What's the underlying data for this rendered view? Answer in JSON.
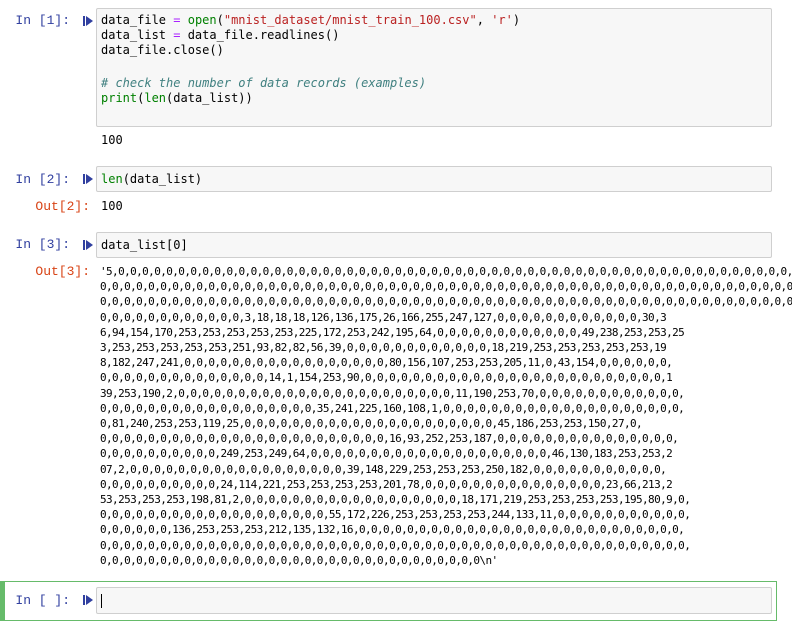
{
  "cells": [
    {
      "in_prompt": "In [1]:",
      "code": [
        "data_file = open(\"mnist_dataset/mnist_train_100.csv\", 'r')",
        "data_list = data_file.readlines()",
        "data_file.close()",
        "",
        "# check the number of data records (examples)",
        "print(len(data_list))"
      ],
      "output": "100"
    },
    {
      "in_prompt": "In [2]:",
      "code": [
        "len(data_list)"
      ],
      "out_prompt": "Out[2]:",
      "output": "100"
    },
    {
      "in_prompt": "In [3]:",
      "code": [
        "data_list[0]"
      ],
      "out_prompt": "Out[3]:",
      "output_lines": [
        "'5,0,0,0,0,0,0,0,0,0,0,0,0,0,0,0,0,0,0,0,0,0,0,0,0,0,0,0,0,0,0,0,0,0,0,0,0,0,0,0,0,0,0,0,0,0,0,0,0,0,0,0,0,0,0,0,0,",
        "0,0,0,0,0,0,0,0,0,0,0,0,0,0,0,0,0,0,0,0,0,0,0,0,0,0,0,0,0,0,0,0,0,0,0,0,0,0,0,0,0,0,0,0,0,0,0,0,0,0,0,0,0,0,0,0,0,0,",
        "0,0,0,0,0,0,0,0,0,0,0,0,0,0,0,0,0,0,0,0,0,0,0,0,0,0,0,0,0,0,0,0,0,0,0,0,0,0,0,0,0,0,0,0,0,0,0,0,0,0,0,0,0,0,0,0,0,0,",
        "0,0,0,0,0,0,0,0,0,0,0,0,3,18,18,18,126,136,175,26,166,255,247,127,0,0,0,0,0,0,0,0,0,0,0,0,30,3",
        "6,94,154,170,253,253,253,253,253,225,172,253,242,195,64,0,0,0,0,0,0,0,0,0,0,0,0,49,238,253,253,25",
        "3,253,253,253,253,253,251,93,82,82,56,39,0,0,0,0,0,0,0,0,0,0,0,0,18,219,253,253,253,253,253,19",
        "8,182,247,241,0,0,0,0,0,0,0,0,0,0,0,0,0,0,0,0,0,80,156,107,253,253,205,11,0,43,154,0,0,0,0,0,0,",
        "0,0,0,0,0,0,0,0,0,0,0,0,0,0,14,1,154,253,90,0,0,0,0,0,0,0,0,0,0,0,0,0,0,0,0,0,0,0,0,0,0,0,0,0,1",
        "39,253,190,2,0,0,0,0,0,0,0,0,0,0,0,0,0,0,0,0,0,0,0,0,0,0,0,11,190,253,70,0,0,0,0,0,0,0,0,0,0,0,0,",
        "0,0,0,0,0,0,0,0,0,0,0,0,0,0,0,0,0,0,35,241,225,160,108,1,0,0,0,0,0,0,0,0,0,0,0,0,0,0,0,0,0,0,0,0,",
        "0,81,240,253,253,119,25,0,0,0,0,0,0,0,0,0,0,0,0,0,0,0,0,0,0,0,0,0,45,186,253,253,150,27,0,",
        "0,0,0,0,0,0,0,0,0,0,0,0,0,0,0,0,0,0,0,0,0,0,0,0,16,93,252,253,187,0,0,0,0,0,0,0,0,0,0,0,0,0,0,0,",
        "0,0,0,0,0,0,0,0,0,0,249,253,249,64,0,0,0,0,0,0,0,0,0,0,0,0,0,0,0,0,0,0,0,0,46,130,183,253,253,2",
        "07,2,0,0,0,0,0,0,0,0,0,0,0,0,0,0,0,0,0,0,39,148,229,253,253,253,250,182,0,0,0,0,0,0,0,0,0,0,0,",
        "0,0,0,0,0,0,0,0,0,0,24,114,221,253,253,253,253,201,78,0,0,0,0,0,0,0,0,0,0,0,0,0,0,0,23,66,213,2",
        "53,253,253,253,198,81,2,0,0,0,0,0,0,0,0,0,0,0,0,0,0,0,0,0,0,18,171,219,253,253,253,253,195,80,9,0,",
        "0,0,0,0,0,0,0,0,0,0,0,0,0,0,0,0,0,0,0,55,172,226,253,253,253,253,244,133,11,0,0,0,0,0,0,0,0,0,0,0,",
        "0,0,0,0,0,0,136,253,253,253,212,135,132,16,0,0,0,0,0,0,0,0,0,0,0,0,0,0,0,0,0,0,0,0,0,0,0,0,0,0,0,",
        "0,0,0,0,0,0,0,0,0,0,0,0,0,0,0,0,0,0,0,0,0,0,0,0,0,0,0,0,0,0,0,0,0,0,0,0,0,0,0,0,0,0,0,0,0,0,0,0,0,",
        "0,0,0,0,0,0,0,0,0,0,0,0,0,0,0,0,0,0,0,0,0,0,0,0,0,0,0,0,0,0,0,0\\n'"
      ]
    },
    {
      "in_prompt": "In [ ]:",
      "code": [
        ""
      ]
    }
  ],
  "colors": {
    "in_prompt": "#303f9f",
    "out_prompt": "#d84315",
    "selected_border": "#66bb6a",
    "input_bg": "#f7f7f7"
  },
  "icons": {
    "run": "run-cell-icon"
  }
}
